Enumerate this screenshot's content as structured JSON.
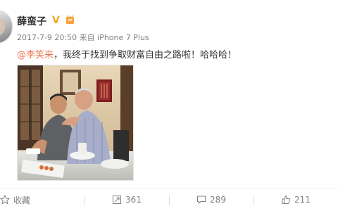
{
  "post": {
    "author": "薛蛮子",
    "verified_badge": "V",
    "timestamp": "2017-7-9 20:50",
    "source_prefix": "来自",
    "source_device": "iPhone 7 Plus",
    "mention": "@李笑来",
    "text": "，我终于找到争取财富自由之路啦！哈哈哈！"
  },
  "actions": {
    "favorite_label": "收藏",
    "repost_count": "361",
    "comment_count": "289",
    "like_count": "211"
  },
  "colors": {
    "mention": "#eb7350",
    "verified": "#f5a623",
    "meta": "#808080"
  },
  "icons": [
    "star-icon",
    "repost-icon",
    "comment-icon",
    "like-icon",
    "level-badge-icon"
  ]
}
